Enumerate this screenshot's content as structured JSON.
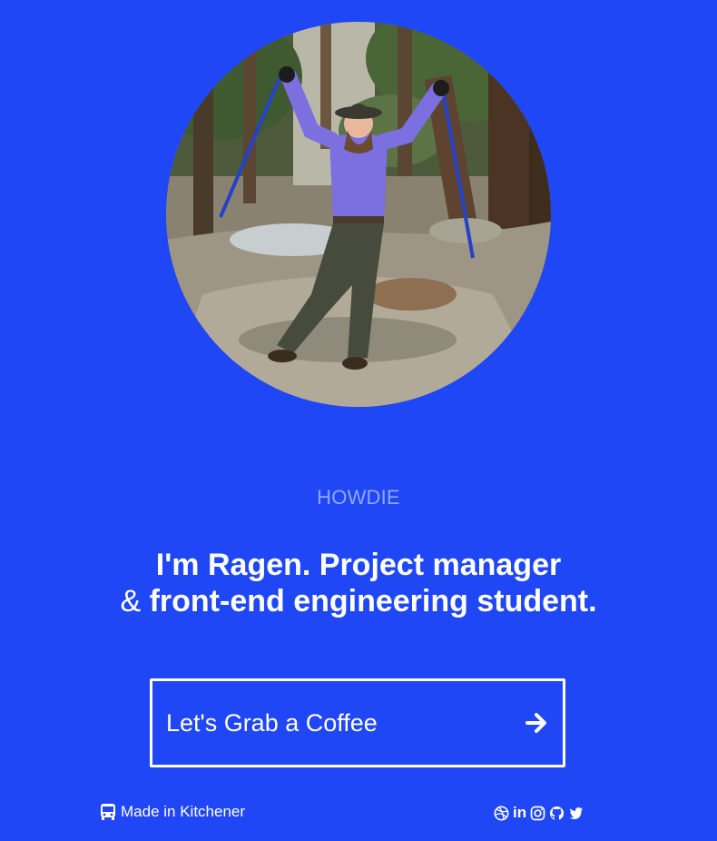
{
  "hero": {
    "eyebrow": "HOWDIE",
    "headline_line1": "I'm Ragen. Project manager",
    "headline_amp": "&",
    "headline_line2": "front-end engineering student."
  },
  "cta": {
    "label": "Let's Grab a Coffee",
    "icon": "arrow-right-icon"
  },
  "footer": {
    "location_icon": "bus-icon",
    "location": "Made in Kitchener",
    "social": [
      {
        "icon": "dribbble-icon"
      },
      {
        "icon": "linkedin-icon",
        "text": "in"
      },
      {
        "icon": "instagram-icon"
      },
      {
        "icon": "github-icon"
      },
      {
        "icon": "twitter-icon"
      }
    ]
  },
  "colors": {
    "background": "#1f47f5",
    "eyebrow": "#93a6fa",
    "text": "#ffffff"
  }
}
